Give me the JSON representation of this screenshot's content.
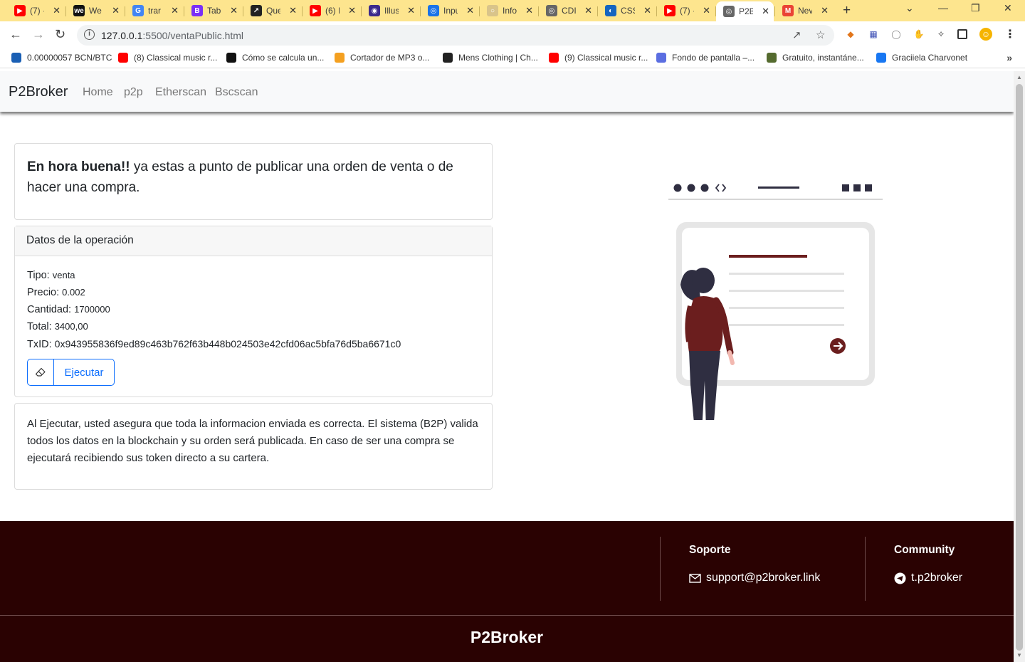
{
  "browser": {
    "tabs": [
      {
        "title": "(7) ·",
        "color": "#ff0000",
        "glyph": "▶"
      },
      {
        "title": "We",
        "color": "#111111",
        "glyph": "we"
      },
      {
        "title": "trar",
        "color": "#4285f4",
        "glyph": "G"
      },
      {
        "title": "Tab",
        "color": "#7b2ff7",
        "glyph": "B"
      },
      {
        "title": "Que",
        "color": "#222222",
        "glyph": "↗"
      },
      {
        "title": "(6) I",
        "color": "#ff0000",
        "glyph": "▶"
      },
      {
        "title": "Illus",
        "color": "#3b2a8c",
        "glyph": "◉"
      },
      {
        "title": "Inpu",
        "color": "#1a73e8",
        "glyph": "◎"
      },
      {
        "title": "Info",
        "color": "#d9c48a",
        "glyph": "○"
      },
      {
        "title": "CDI",
        "color": "#666666",
        "glyph": "◎"
      },
      {
        "title": "CSS",
        "color": "#1565c0",
        "glyph": "◐"
      },
      {
        "title": "(7) ·",
        "color": "#ff0000",
        "glyph": "▶"
      },
      {
        "title": "P2B",
        "color": "#666666",
        "glyph": "◎"
      },
      {
        "title": "Nev",
        "color": "#ea4335",
        "glyph": "M"
      }
    ],
    "active_tab_index": 12,
    "url_host": "127.0.0.1",
    "url_path": ":5500/ventaPublic.html",
    "bookmarks": [
      {
        "label": "0.00000057 BCN/BTC",
        "color": "#1a5fb4"
      },
      {
        "label": "(8) Classical music r...",
        "color": "#ff0000"
      },
      {
        "label": "Cómo se calcula un...",
        "color": "#111111"
      },
      {
        "label": "Cortador de MP3 o...",
        "color": "#f4a020"
      },
      {
        "label": "Mens Clothing | Ch...",
        "color": "#222222"
      },
      {
        "label": "(9) Classical music r...",
        "color": "#ff0000"
      },
      {
        "label": "Fondo de pantalla –...",
        "color": "#5b6ee1"
      },
      {
        "label": "Gratuito, instantáne...",
        "color": "#556b2f"
      },
      {
        "label": "Graciiela Charvonet",
        "color": "#1877f2"
      }
    ]
  },
  "nav": {
    "brand": "P2Broker",
    "links": [
      "Home",
      "p2p",
      "Etherscan",
      "Bscscan"
    ]
  },
  "intro": {
    "bold": "En hora buena!!",
    "text": " ya estas a punto de publicar una orden de venta o de hacer una compra."
  },
  "operation": {
    "header": "Datos de la operación",
    "tipo_label": "Tipo:",
    "tipo_value": "venta",
    "precio_label": "Precio:",
    "precio_value": "0.002",
    "cantidad_label": "Cantidad:",
    "cantidad_value": "1700000",
    "total_label": "Total:",
    "total_value": "3400,00",
    "txid_label": "TxID:",
    "txid_value": "0x943955836f9ed89c463b762f63b448b024503e42cfd06ac5bfa76d5ba6671c0",
    "button_label": "Ejecutar",
    "button_icon": "eraser-icon"
  },
  "notice": {
    "text": "Al Ejecutar, usted asegura que toda la informacion enviada es correcta. El sistema (B2P) valida todos los datos en la blockchain y su orden será publicada. En caso de ser una compra se ejecutará recibiendo sus token directo a su cartera."
  },
  "footer": {
    "support_heading": "Soporte",
    "support_email": "support@p2broker.link",
    "community_heading": "Community",
    "community_link": "t.p2broker",
    "brand": "P2Broker",
    "bg_color": "#2a0202"
  },
  "colors": {
    "accent": "#0d6efd",
    "illustration_accent": "#6b1e1e"
  }
}
